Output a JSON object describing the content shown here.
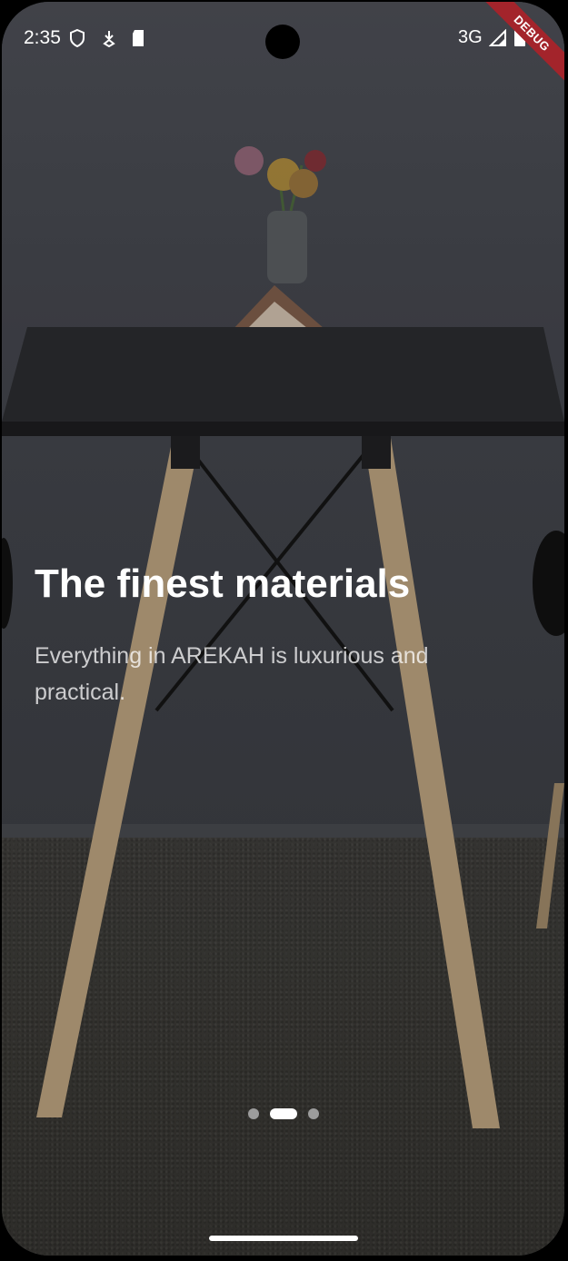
{
  "status_bar": {
    "time": "2:35",
    "network": "3G",
    "debug_label": "DEBUG",
    "icons": [
      "shield-icon",
      "download-icon",
      "sd-card-icon",
      "signal-icon",
      "battery-icon"
    ]
  },
  "onboarding": {
    "title": "The finest materials",
    "subtitle": "Everything in AREKAH is luxurious and practical.",
    "page_indicator": {
      "count": 3,
      "active_index": 1
    }
  },
  "colors": {
    "title": "#ffffff",
    "subtitle": "#c8c8c8",
    "dot_active": "#ffffff",
    "dot_inactive": "#9c9c9c",
    "debug_banner": "#a3242b"
  }
}
